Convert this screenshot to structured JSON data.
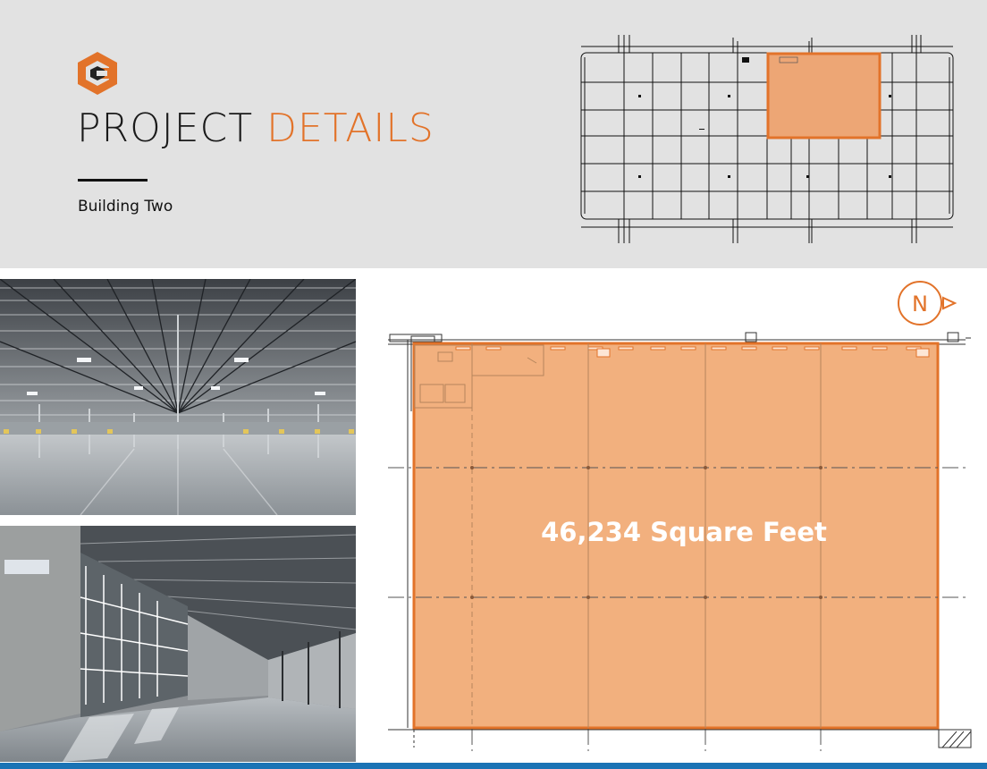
{
  "header": {
    "title_main": "PROJECT",
    "title_accent": "DETAILS",
    "subtitle": "Building Two"
  },
  "floor_plan": {
    "area_label": "46,234 Square Feet",
    "north_label": "N"
  },
  "colors": {
    "accent": "#e2732a",
    "highlight_fill": "#f2b07e",
    "header_bg": "#e2e2e2",
    "footer_bar": "#1a73b5"
  }
}
